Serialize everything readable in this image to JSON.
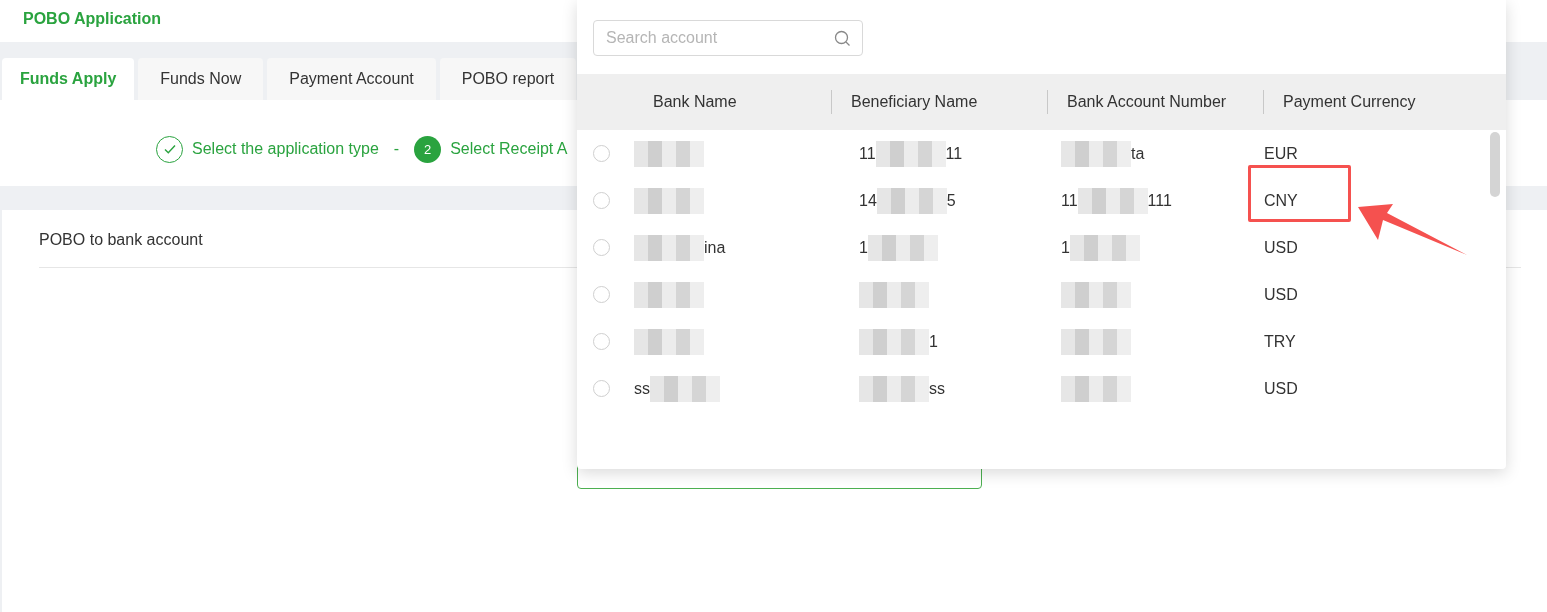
{
  "header": {
    "title": "POBO Application"
  },
  "tabs": [
    {
      "label": "Funds Apply",
      "selected": true
    },
    {
      "label": "Funds Now",
      "selected": false
    },
    {
      "label": "Payment Account",
      "selected": false
    },
    {
      "label": "POBO report",
      "selected": false
    }
  ],
  "steps": [
    {
      "label": "Select the application type",
      "done": true
    },
    {
      "label": "Select Receipt A",
      "done": false,
      "number": "2"
    }
  ],
  "step_separator": "-",
  "card": {
    "title": "POBO to bank account"
  },
  "dropdown": {
    "search": {
      "placeholder": "Search account"
    },
    "columns": [
      "Bank Name",
      "Beneficiary Name",
      "Bank Account Number",
      "Payment Currency"
    ],
    "rows": [
      {
        "selected": false,
        "cells": [
          [
            {
              "kind": "blur"
            }
          ],
          [
            {
              "kind": "text",
              "text": "11"
            },
            {
              "kind": "blur"
            },
            {
              "kind": "text",
              "text": "11"
            }
          ],
          [
            {
              "kind": "blur"
            },
            {
              "kind": "text",
              "text": "ta"
            }
          ],
          [
            {
              "kind": "text",
              "text": "EUR"
            }
          ]
        ]
      },
      {
        "selected": false,
        "cells": [
          [
            {
              "kind": "blur"
            }
          ],
          [
            {
              "kind": "text",
              "text": "14"
            },
            {
              "kind": "blur"
            },
            {
              "kind": "text",
              "text": "5"
            }
          ],
          [
            {
              "kind": "text",
              "text": "11"
            },
            {
              "kind": "blur"
            },
            {
              "kind": "text",
              "text": "111"
            }
          ],
          [
            {
              "kind": "text",
              "text": "CNY"
            }
          ]
        ]
      },
      {
        "selected": false,
        "cells": [
          [
            {
              "kind": "blur"
            },
            {
              "kind": "text",
              "text": "ina"
            }
          ],
          [
            {
              "kind": "text",
              "text": "1"
            },
            {
              "kind": "blur"
            }
          ],
          [
            {
              "kind": "text",
              "text": "1"
            },
            {
              "kind": "blur"
            }
          ],
          [
            {
              "kind": "text",
              "text": "USD"
            }
          ]
        ]
      },
      {
        "selected": false,
        "cells": [
          [
            {
              "kind": "blur"
            }
          ],
          [
            {
              "kind": "blur"
            }
          ],
          [
            {
              "kind": "blur"
            }
          ],
          [
            {
              "kind": "text",
              "text": "USD"
            }
          ]
        ]
      },
      {
        "selected": false,
        "cells": [
          [
            {
              "kind": "blur"
            }
          ],
          [
            {
              "kind": "blur"
            },
            {
              "kind": "text",
              "text": "1"
            }
          ],
          [
            {
              "kind": "blur"
            }
          ],
          [
            {
              "kind": "text",
              "text": "TRY"
            }
          ]
        ]
      },
      {
        "selected": false,
        "cells": [
          [
            {
              "kind": "text",
              "text": "ss"
            },
            {
              "kind": "blur"
            }
          ],
          [
            {
              "kind": "blur"
            },
            {
              "kind": "text",
              "text": "ss"
            }
          ],
          [
            {
              "kind": "blur"
            }
          ],
          [
            {
              "kind": "text",
              "text": "USD"
            }
          ]
        ]
      }
    ]
  }
}
